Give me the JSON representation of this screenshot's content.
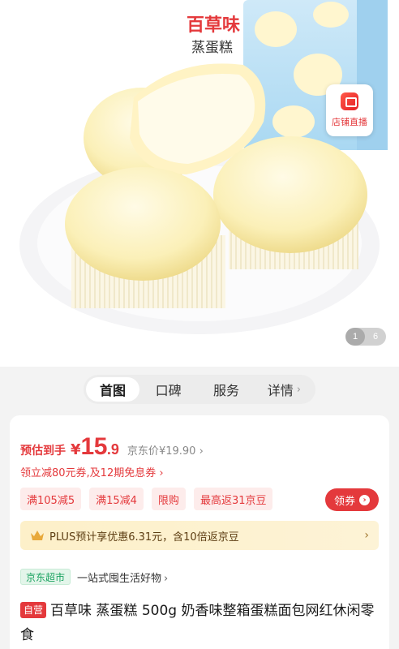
{
  "hero": {
    "brand_name": "百草味",
    "product_label": "蒸蛋糕",
    "live_button_label": "店铺直播",
    "pager_current": "1",
    "pager_total": "6"
  },
  "tabs": [
    {
      "label": "首图",
      "active": true
    },
    {
      "label": "口碑",
      "active": false
    },
    {
      "label": "服务",
      "active": false
    },
    {
      "label": "详情",
      "active": false
    }
  ],
  "tab_more_arrow": "›",
  "price": {
    "estimate_label": "预估到手",
    "currency": "¥",
    "integer": "15",
    "decimal": ".9",
    "jd_price_label": "京东价",
    "jd_price_value": "¥19.90",
    "jd_price_arrow": "›"
  },
  "coupon_line": "领立减80元券,及12期免息券 ›",
  "promo_tags": [
    "满105减5",
    "满15减4",
    "限购",
    "最高返31京豆"
  ],
  "get_coupon": {
    "label": "领券",
    "arrow": "›"
  },
  "plus": {
    "text": "PLUS预计享优惠6.31元，含10倍返京豆",
    "chevron": "›"
  },
  "store": {
    "badge": "京东超市",
    "slogan": "一站式囤生活好物",
    "chevron": "›"
  },
  "product": {
    "self_tag": "自营",
    "title": "百草味 蒸蛋糕 500g 奶香味整箱蛋糕面包网红休闲零食"
  },
  "colors": {
    "accent_red": "#e4393c",
    "plus_gold": "#fdf0c9",
    "jd_super_green": "#1aa260"
  }
}
